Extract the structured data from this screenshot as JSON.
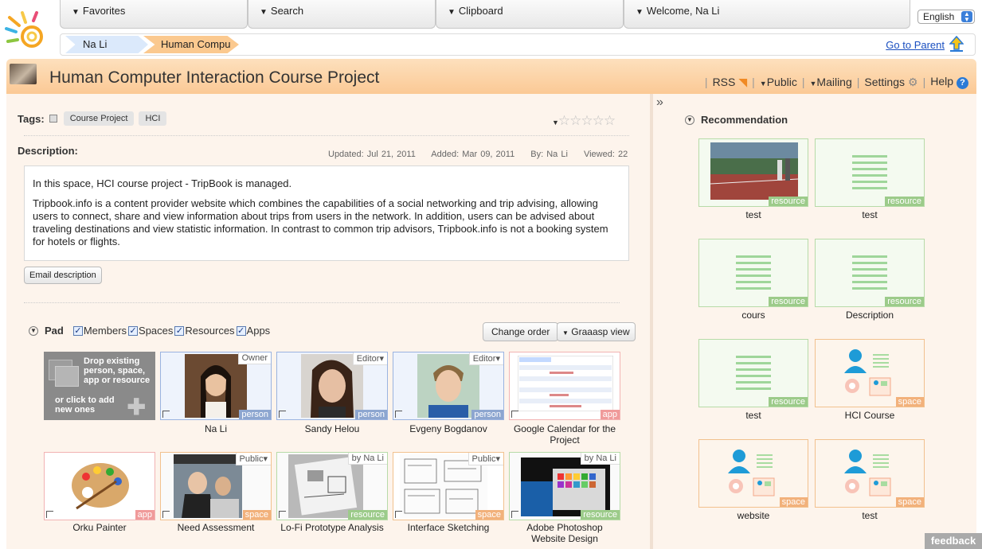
{
  "nav": {
    "favorites": "Favorites",
    "search": "Search",
    "clipboard": "Clipboard",
    "welcome": "Welcome, Na Li",
    "language": "English"
  },
  "breadcrumb": {
    "items": [
      "Na Li",
      "Human Compu"
    ],
    "go_to_parent": "Go to Parent"
  },
  "header": {
    "title": "Human Computer Interaction Course Project",
    "menu": [
      "RSS",
      "Public",
      "Mailing",
      "Settings",
      "Help"
    ]
  },
  "tags": {
    "label": "Tags:",
    "items": [
      "Course Project",
      "HCI"
    ],
    "rating_stars": 0,
    "rating_max": 5
  },
  "description": {
    "label": "Description:",
    "updated": "Updated: Jul 21, 2011",
    "added": "Added: Mar 09, 2011",
    "by": "By: Na Li",
    "viewed": "Viewed: 22",
    "para1": "In this space, HCI course project - TripBook is managed.",
    "para2": "Tripbook.info is a content provider website which combines the capabilities of a social networking and trip advising, allowing users to connect, share and view information about trips from users in the network. In addition, users can be advised about traveling destinations and view statistic information. In contrast to common trip advisors, Tripbook.info is not a booking system for hotels or flights.",
    "email_button": "Email description"
  },
  "pad": {
    "label": "Pad",
    "filters": [
      "Members",
      "Spaces",
      "Resources",
      "Apps"
    ],
    "change_order": "Change order",
    "view_button": "Graaasp view",
    "drop_text": "Drop existing person, space, app or resource",
    "click_text": "or click to add new ones",
    "items": [
      {
        "label": "Na Li",
        "role": "Owner",
        "type": "person"
      },
      {
        "label": "Sandy Helou",
        "role": "Editor",
        "type": "person"
      },
      {
        "label": "Evgeny Bogdanov",
        "role": "Editor",
        "type": "person"
      },
      {
        "label": "Google Calendar for the Project",
        "role": "",
        "type": "app"
      },
      {
        "label": "Orku Painter",
        "role": "",
        "type": "app"
      },
      {
        "label": "Need Assessment",
        "role": "Public",
        "type": "space"
      },
      {
        "label": "Lo-Fi Prototype Analysis",
        "role": "by Na Li",
        "type": "resource"
      },
      {
        "label": "Interface Sketching",
        "role": "Public",
        "type": "space"
      },
      {
        "label": "Adobe Photoshop Website Design",
        "role": "by Na Li",
        "type": "resource"
      }
    ]
  },
  "recommendation": {
    "label": "Recommendation",
    "items": [
      {
        "label": "test",
        "type": "resource"
      },
      {
        "label": "test",
        "type": "resource"
      },
      {
        "label": "cours",
        "type": "resource"
      },
      {
        "label": "Description",
        "type": "resource"
      },
      {
        "label": "test",
        "type": "resource"
      },
      {
        "label": "HCI Course",
        "type": "space"
      },
      {
        "label": "website",
        "type": "space"
      },
      {
        "label": "test",
        "type": "space"
      }
    ]
  },
  "feedback": "feedback"
}
